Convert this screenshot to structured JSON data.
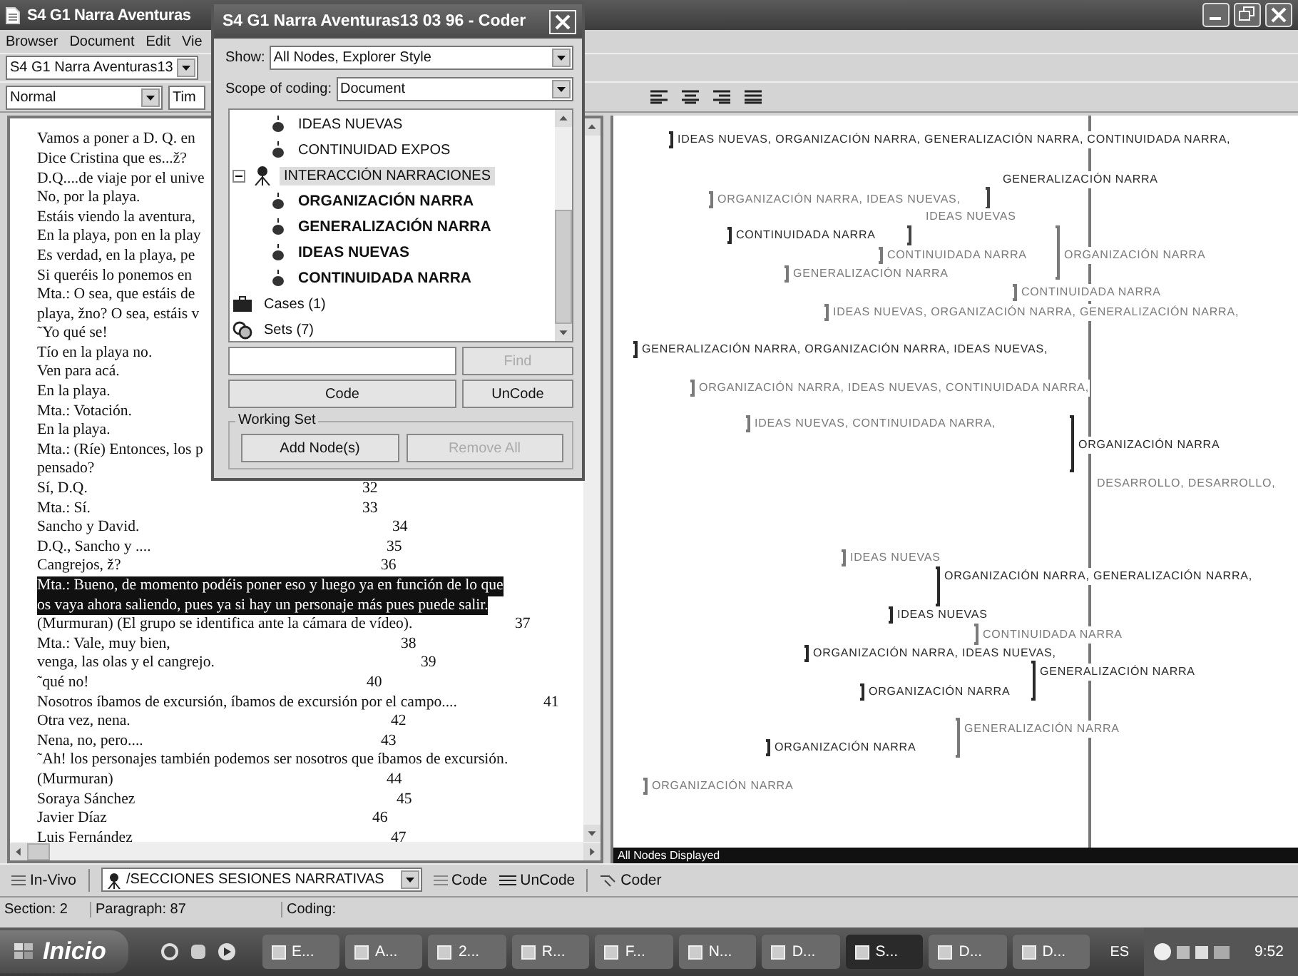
{
  "main_window": {
    "title": "S4 G1 Narra Aventuras",
    "menu": [
      "Browser",
      "Document",
      "Edit",
      "Vie"
    ],
    "document_combo": "S4 G1 Narra Aventuras13",
    "style_combo": "Normal",
    "font_combo": "Tim",
    "document_lines": [
      {
        "text": "Vamos a poner a D. Q. en",
        "selected": false
      },
      {
        "text": "Dice Cristina que es...ž?",
        "selected": false
      },
      {
        "text": "D.Q....de viaje por el unive",
        "selected": false
      },
      {
        "text": "No, por la playa.",
        "selected": false
      },
      {
        "text": "Estáis viendo la aventura,",
        "selected": false
      },
      {
        "text": "En la playa, pon en la play",
        "selected": false
      },
      {
        "text": "Es verdad, en la playa, pe",
        "selected": false
      },
      {
        "text": "Si queréis lo ponemos en",
        "selected": false
      },
      {
        "text": "Mta.: O sea, que estáis de",
        "selected": false
      },
      {
        "text": "playa, žno? O sea, estáis v",
        "selected": false
      },
      {
        "text": "˜Yo qué se!",
        "selected": false
      },
      {
        "text": "Tío en la playa no.",
        "selected": false
      },
      {
        "text": "Ven para acá.",
        "selected": false
      },
      {
        "text": "En la playa.",
        "selected": false
      },
      {
        "text": "Mta.: Votación.",
        "selected": false
      },
      {
        "text": "En la playa.",
        "selected": false
      },
      {
        "text": "Mta.: (Ríe) Entonces, los p",
        "selected": false
      },
      {
        "text": "pensado?",
        "selected": false
      },
      {
        "text": "Sí, D.Q.",
        "number": "32",
        "selected": false
      },
      {
        "text": "Mta.: Sí.",
        "number": "33",
        "selected": false
      },
      {
        "text": "Sancho y David.",
        "number": "34",
        "selected": false
      },
      {
        "text": "D.Q., Sancho y ....",
        "number": "35",
        "selected": false
      },
      {
        "text": "Cangrejos, ž?",
        "number": "36",
        "selected": false
      },
      {
        "text": "Mta.: Bueno, de momento podéis poner eso y luego ya en función de lo que",
        "selected": true
      },
      {
        "text": "os vaya ahora saliendo, pues ya si hay un personaje más pues puede salir.",
        "selected": true
      },
      {
        "text": "(Murmuran) (El grupo se identifica ante la cámara de vídeo).",
        "number": "37",
        "selected": false
      },
      {
        "text": "Mta.: Vale, muy bien,",
        "number": "38",
        "selected": false
      },
      {
        "text": "venga, las olas y el cangrejo.",
        "number": "39",
        "selected": false
      },
      {
        "text": "˜qué no!",
        "number": "40",
        "selected": false
      },
      {
        "text": "Nosotros íbamos de excursión, íbamos de excursión por el campo....",
        "number": "41",
        "selected": false
      },
      {
        "text": "Otra vez, nena.",
        "number": "42",
        "selected": false
      },
      {
        "text": "Nena, no, pero....",
        "number": "43",
        "selected": false
      },
      {
        "text": "˜Ah! los personajes también podemos ser nosotros que íbamos de excursión.",
        "selected": false
      },
      {
        "text": "(Murmuran)",
        "number": "44",
        "selected": false
      },
      {
        "text": "Soraya Sánchez",
        "number": "45",
        "selected": false
      },
      {
        "text": "Javier Díaz",
        "number": "46",
        "selected": false
      },
      {
        "text": "Luis Fernández",
        "number": "47",
        "selected": false
      }
    ],
    "coding_stripes": [
      {
        "text": "IDEAS NUEVAS, ORGANIZACIÓN NARRA, GENERALIZACIÓN NARRA, CONTINUIDADA NARRA,",
        "color": "#2a2a2a"
      },
      {
        "text": "GENERALIZACIÓN NARRA",
        "color": "#2a2a2a"
      },
      {
        "text": "ORGANIZACIÓN NARRA, IDEAS NUEVAS,",
        "color": "#7a7a7a"
      },
      {
        "text": "IDEAS NUEVAS",
        "color": "#7a7a7a"
      },
      {
        "text": "CONTINUIDADA NARRA",
        "color": "#2a2a2a"
      },
      {
        "text": "CONTINUIDADA NARRA",
        "color": "#7a7a7a"
      },
      {
        "text": "ORGANIZACIÓN NARRA",
        "color": "#7a7a7a"
      },
      {
        "text": "GENERALIZACIÓN NARRA",
        "color": "#7a7a7a"
      },
      {
        "text": "CONTINUIDADA NARRA",
        "color": "#7a7a7a"
      },
      {
        "text": "IDEAS NUEVAS, ORGANIZACIÓN NARRA, GENERALIZACIÓN NARRA,",
        "color": "#7a7a7a"
      },
      {
        "text": "GENERALIZACIÓN NARRA, ORGANIZACIÓN NARRA, IDEAS NUEVAS,",
        "color": "#2a2a2a"
      },
      {
        "text": "ORGANIZACIÓN NARRA, IDEAS NUEVAS, CONTINUIDADA NARRA,",
        "color": "#7a7a7a"
      },
      {
        "text": "IDEAS NUEVAS, CONTINUIDADA NARRA,",
        "color": "#7a7a7a"
      },
      {
        "text": "ORGANIZACIÓN NARRA",
        "color": "#2a2a2a"
      },
      {
        "text": "DESARROLLO, DESARROLLO,",
        "color": "#7a7a7a"
      },
      {
        "text": "IDEAS NUEVAS",
        "color": "#7a7a7a"
      },
      {
        "text": "ORGANIZACIÓN NARRA, GENERALIZACIÓN NARRA,",
        "color": "#2a2a2a"
      },
      {
        "text": "IDEAS NUEVAS",
        "color": "#2a2a2a"
      },
      {
        "text": "CONTINUIDADA NARRA",
        "color": "#7a7a7a"
      },
      {
        "text": "ORGANIZACIÓN NARRA, IDEAS NUEVAS,",
        "color": "#2a2a2a"
      },
      {
        "text": "GENERALIZACIÓN NARRA",
        "color": "#2a2a2a"
      },
      {
        "text": "ORGANIZACIÓN NARRA",
        "color": "#2a2a2a"
      },
      {
        "text": "GENERALIZACIÓN NARRA",
        "color": "#7a7a7a"
      },
      {
        "text": "ORGANIZACIÓN NARRA",
        "color": "#2a2a2a"
      },
      {
        "text": "ORGANIZACIÓN NARRA",
        "color": "#7a7a7a"
      }
    ],
    "stripes_status": "All Nodes Displayed",
    "coding_bar": {
      "in_vivo": "In-Vivo",
      "node": "/SECCIONES SESIONES NARRATIVAS",
      "code": "Code",
      "uncode": "UnCode",
      "coder": "Coder"
    },
    "status_bar": {
      "section": "Section: 2",
      "paragraph": "Paragraph: 87",
      "coding": "Coding:"
    }
  },
  "coder_dialog": {
    "title": "S4 G1 Narra Aventuras13 03 96 - Coder",
    "show_label": "Show:",
    "show_value": "All Nodes, Explorer Style",
    "scope_label": "Scope of coding:",
    "scope_value": "Document",
    "tree": [
      {
        "children": [
          {
            "label": "IDEAS NUEVAS",
            "kind": "node",
            "coded": false,
            "selected": false
          },
          {
            "label": "CONTINUIDAD EXPOS",
            "kind": "node",
            "coded": false,
            "selected": false
          }
        ]
      },
      {
        "label": "INTERACCIÓN NARRACIONES",
        "kind": "parent",
        "expanded": true,
        "selected": true,
        "children": [
          {
            "label": "ORGANIZACIÓN NARRA",
            "kind": "node",
            "coded": true,
            "selected": false
          },
          {
            "label": "GENERALIZACIÓN NARRA",
            "kind": "node",
            "coded": true,
            "selected": false
          },
          {
            "label": "IDEAS NUEVAS",
            "kind": "node",
            "coded": true,
            "selected": false
          },
          {
            "label": "CONTINUIDADA NARRA",
            "kind": "node",
            "coded": true,
            "selected": false
          }
        ]
      },
      {
        "label": "Cases (1)",
        "kind": "cases",
        "selected": false
      },
      {
        "label": "Sets (7)",
        "kind": "sets",
        "selected": false
      }
    ],
    "find_button": {
      "label": "Find",
      "disabled": true
    },
    "code_button": {
      "label": "Code",
      "disabled": false
    },
    "uncode_button": {
      "label": "UnCode",
      "disabled": false
    },
    "working_set": {
      "label": "Working Set",
      "add_button": {
        "label": "Add Node(s)",
        "disabled": false
      },
      "remove_button": {
        "label": "Remove All",
        "disabled": true
      }
    }
  },
  "taskbar": {
    "start": "Inicio",
    "tasks": [
      {
        "label": "E...",
        "selected": false
      },
      {
        "label": "A...",
        "selected": false
      },
      {
        "label": "2...",
        "selected": false
      },
      {
        "label": "R...",
        "selected": false
      },
      {
        "label": "F...",
        "selected": false
      },
      {
        "label": "N...",
        "selected": false
      },
      {
        "label": "D...",
        "selected": false
      },
      {
        "label": "S...",
        "selected": true
      },
      {
        "label": "D...",
        "selected": false
      },
      {
        "label": "D...",
        "selected": false
      }
    ],
    "language": "ES",
    "clock": "9:52"
  }
}
